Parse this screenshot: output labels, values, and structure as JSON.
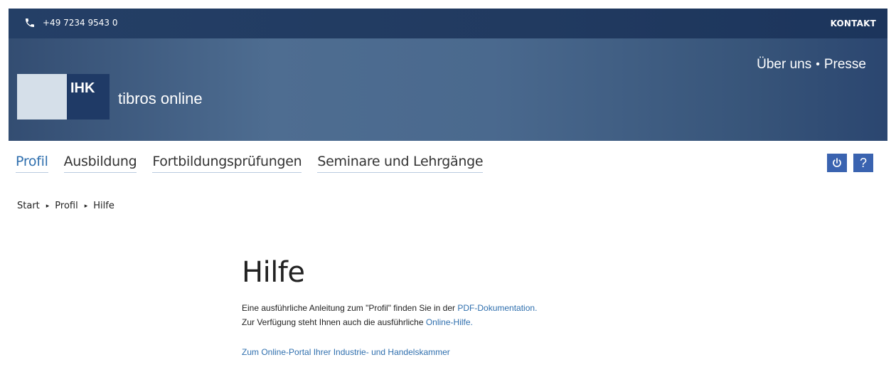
{
  "topbar": {
    "phone": "+49 7234 9543 0",
    "phone_icon": "phone-icon",
    "contact_label": "KONTAKT"
  },
  "header": {
    "logo_text": "IHK",
    "brand_name": "tibros online",
    "meta_nav": [
      {
        "label": "Über uns"
      },
      {
        "label": "Presse"
      }
    ],
    "meta_separator": "•"
  },
  "main_nav": {
    "items": [
      {
        "label": "Profil",
        "active": true
      },
      {
        "label": "Ausbildung",
        "active": false
      },
      {
        "label": "Fortbildungsprüfungen",
        "active": false
      },
      {
        "label": "Seminare und Lehrgänge",
        "active": false
      }
    ],
    "icons": [
      {
        "name": "power-icon"
      },
      {
        "name": "help-icon",
        "glyph": "?"
      }
    ]
  },
  "breadcrumb": {
    "items": [
      "Start",
      "Profil",
      "Hilfe"
    ],
    "separator": "▸"
  },
  "content": {
    "title": "Hilfe",
    "line1_text": "Eine ausführliche Anleitung zum \"Profil\" finden Sie in der ",
    "line1_link": "PDF-Dokumentation.",
    "line2_text": "Zur Verfügung steht Ihnen auch die ausführliche ",
    "line2_link": "Online-Hilfe.",
    "portal_link": "Zum Online-Portal Ihrer Industrie- und Handelskammer"
  },
  "colors": {
    "accent": "#2f6fae",
    "button": "#3a63b0",
    "header_dark": "#243f66"
  }
}
